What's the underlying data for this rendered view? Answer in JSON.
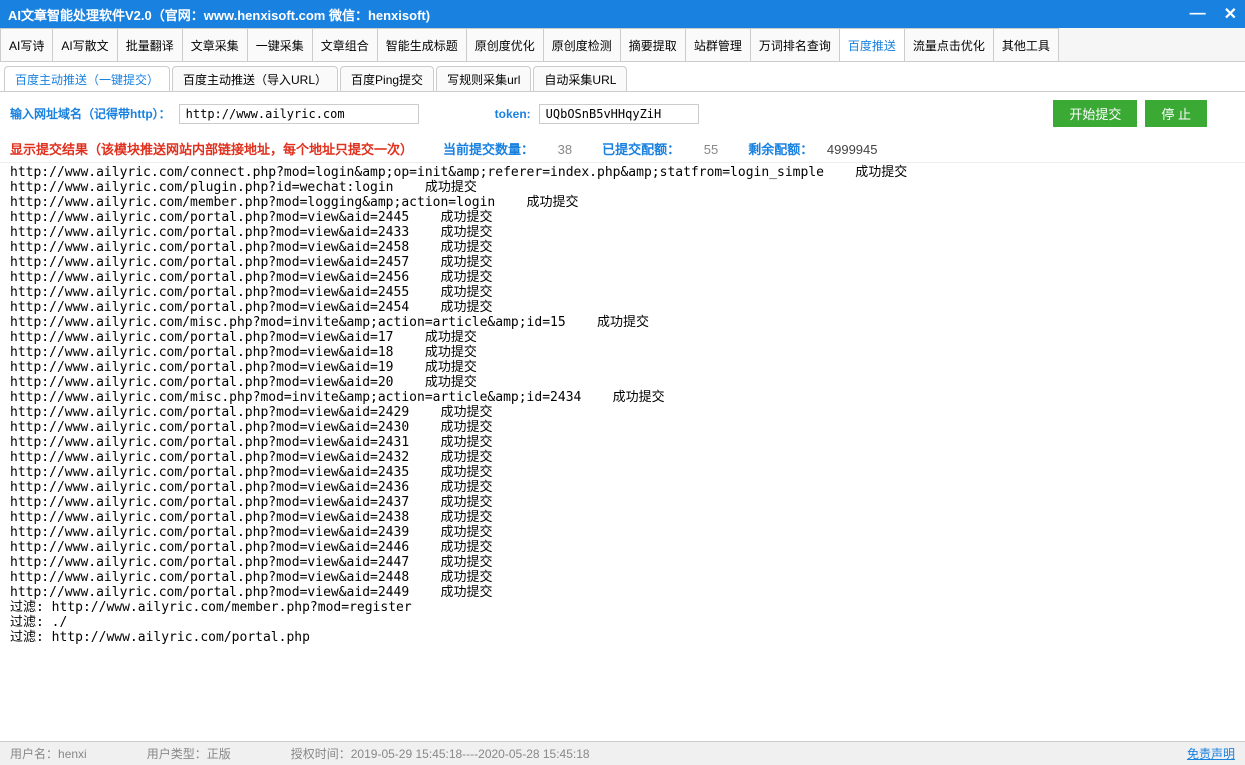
{
  "title": "AI文章智能处理软件V2.0（官网：www.henxisoft.com  微信：henxisoft)",
  "tabs": [
    {
      "label": "AI写诗"
    },
    {
      "label": "AI写散文"
    },
    {
      "label": "批量翻译"
    },
    {
      "label": "文章采集"
    },
    {
      "label": "一键采集"
    },
    {
      "label": "文章组合"
    },
    {
      "label": "智能生成标题"
    },
    {
      "label": "原创度优化"
    },
    {
      "label": "原创度检测"
    },
    {
      "label": "摘要提取"
    },
    {
      "label": "站群管理"
    },
    {
      "label": "万词排名查询"
    },
    {
      "label": "百度推送",
      "active": true
    },
    {
      "label": "流量点击优化"
    },
    {
      "label": "其他工具"
    }
  ],
  "subtabs": [
    {
      "label": "百度主动推送（一键提交）",
      "active": true
    },
    {
      "label": "百度主动推送（导入URL）"
    },
    {
      "label": "百度Ping提交"
    },
    {
      "label": "写规则采集url"
    },
    {
      "label": "自动采集URL"
    }
  ],
  "input": {
    "domain_label": "输入网址域名（记得带http）：",
    "domain_value": "http://www.ailyric.com",
    "token_label": "token:",
    "token_value": "UQbOSnB5vHHqyZiH",
    "start_btn": "开始提交",
    "stop_btn": "停  止"
  },
  "stats": {
    "result_label": "显示提交结果（该模块推送网站内部链接地址，每个地址只提交一次）",
    "current_label": "当前提交数量：",
    "current_value": "38",
    "quota_label": "已提交配额：",
    "quota_value": "55",
    "remain_label": "剩余配额：",
    "remain_value": "4999945"
  },
  "results": [
    "http://www.ailyric.com/connect.php?mod=login&amp;op=init&amp;referer=index.php&amp;statfrom=login_simple    成功提交",
    "http://www.ailyric.com/plugin.php?id=wechat:login    成功提交",
    "http://www.ailyric.com/member.php?mod=logging&amp;action=login    成功提交",
    "http://www.ailyric.com/portal.php?mod=view&aid=2445    成功提交",
    "http://www.ailyric.com/portal.php?mod=view&aid=2433    成功提交",
    "http://www.ailyric.com/portal.php?mod=view&aid=2458    成功提交",
    "http://www.ailyric.com/portal.php?mod=view&aid=2457    成功提交",
    "http://www.ailyric.com/portal.php?mod=view&aid=2456    成功提交",
    "http://www.ailyric.com/portal.php?mod=view&aid=2455    成功提交",
    "http://www.ailyric.com/portal.php?mod=view&aid=2454    成功提交",
    "http://www.ailyric.com/misc.php?mod=invite&amp;action=article&amp;id=15    成功提交",
    "http://www.ailyric.com/portal.php?mod=view&aid=17    成功提交",
    "http://www.ailyric.com/portal.php?mod=view&aid=18    成功提交",
    "http://www.ailyric.com/portal.php?mod=view&aid=19    成功提交",
    "http://www.ailyric.com/portal.php?mod=view&aid=20    成功提交",
    "http://www.ailyric.com/misc.php?mod=invite&amp;action=article&amp;id=2434    成功提交",
    "http://www.ailyric.com/portal.php?mod=view&aid=2429    成功提交",
    "http://www.ailyric.com/portal.php?mod=view&aid=2430    成功提交",
    "http://www.ailyric.com/portal.php?mod=view&aid=2431    成功提交",
    "http://www.ailyric.com/portal.php?mod=view&aid=2432    成功提交",
    "http://www.ailyric.com/portal.php?mod=view&aid=2435    成功提交",
    "http://www.ailyric.com/portal.php?mod=view&aid=2436    成功提交",
    "http://www.ailyric.com/portal.php?mod=view&aid=2437    成功提交",
    "http://www.ailyric.com/portal.php?mod=view&aid=2438    成功提交",
    "http://www.ailyric.com/portal.php?mod=view&aid=2439    成功提交",
    "http://www.ailyric.com/portal.php?mod=view&aid=2446    成功提交",
    "http://www.ailyric.com/portal.php?mod=view&aid=2447    成功提交",
    "http://www.ailyric.com/portal.php?mod=view&aid=2448    成功提交",
    "http://www.ailyric.com/portal.php?mod=view&aid=2449    成功提交",
    "",
    "过滤: http://www.ailyric.com/member.php?mod=register",
    "过滤: ./",
    "过滤: http://www.ailyric.com/portal.php"
  ],
  "status": {
    "user_label": "用户名：",
    "user_value": "henxi",
    "type_label": "用户类型：",
    "type_value": "正版",
    "auth_label": "授权时间：",
    "auth_value": "2019-05-29 15:45:18----2020-05-28 15:45:18",
    "disclaimer": "免责声明"
  }
}
